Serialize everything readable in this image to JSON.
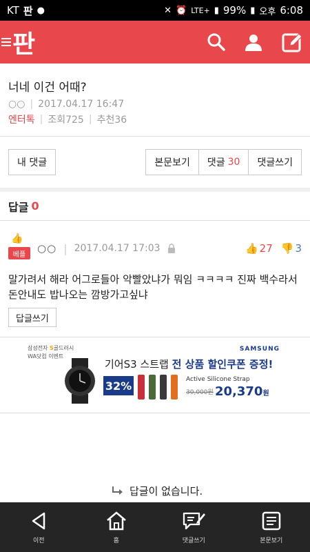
{
  "status_bar": {
    "carrier": "KT",
    "carrier_app": "판",
    "battery": "99%",
    "ampm": "오후",
    "time": "6:08",
    "network": "LTE+"
  },
  "top_bar": {
    "logo": "판",
    "icons": [
      "search-icon",
      "user-icon",
      "write-icon"
    ]
  },
  "article": {
    "title": "너네 이건 어때?",
    "author": "○○",
    "datetime": "2017.04.17 16:47",
    "category": "엔터톡",
    "views_label": "조회725",
    "recommend_label": "추천36"
  },
  "actions": {
    "my_comments": "내 댓글",
    "view_post": "본문보기",
    "comments_label": "댓글",
    "comments_count": "30",
    "write_comment": "댓글쓰기"
  },
  "replies": {
    "label": "답글",
    "count": "0"
  },
  "comment": {
    "badge": "베플",
    "author": "○○",
    "datetime": "2017.04.17 17:03",
    "upvotes": "27",
    "downvotes": "3",
    "body": "말가려서 해라 어그로들아 악빨았냐가 뭐임 ㅋㅋㅋㅋ 진짜 백수라서 돈안내도 밥나오는 깜방가고싶냐",
    "reply_button": "답글쓰기"
  },
  "ad": {
    "brand_line1": "삼성전자",
    "brand_highlight": "S",
    "brand_line1b": "골드러시",
    "brand_line2": "WA닷컴 이벤트",
    "samsung": "SAMSUNG",
    "headline_pre": "기어S3 스트랩",
    "headline_bold": "전 상품 할인쿠폰 증정!",
    "discount": "32%",
    "strap_label": "Active Silicone Strap",
    "old_price": "30,000원",
    "new_price": "20,370",
    "new_price_unit": "원",
    "strap_colors": [
      "#c8313a",
      "#4a6a3a",
      "#3a3a3a",
      "#e07020"
    ]
  },
  "empty": {
    "message": "답글이 없습니다."
  },
  "bottom_nav": [
    {
      "label": "이전",
      "icon": "back-icon"
    },
    {
      "label": "홈",
      "icon": "home-icon"
    },
    {
      "label": "댓글쓰기",
      "icon": "comment-write-icon"
    },
    {
      "label": "본문보기",
      "icon": "document-icon"
    }
  ],
  "colors": {
    "brand": "#e8474b",
    "ad_blue": "#1a3a8a",
    "downvote": "#4a7bb8"
  }
}
